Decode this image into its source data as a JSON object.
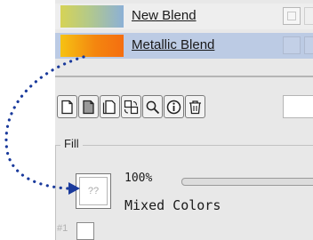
{
  "blends": [
    {
      "name": "New Blend",
      "selected": false,
      "colors": [
        "#d6d356",
        "#8cb0d6"
      ]
    },
    {
      "name": "Metallic Blend",
      "selected": true,
      "colors": [
        "#f6c213",
        "#f46e10"
      ]
    }
  ],
  "toolbar": {
    "buttons": [
      {
        "name": "new-blend-button",
        "icon": "new-document-icon"
      },
      {
        "name": "duplicate-blend-button",
        "icon": "copy-document-icon"
      },
      {
        "name": "blank-blend-button",
        "icon": "blank-document-icon"
      },
      {
        "name": "convert-blend-button",
        "icon": "convert-icon"
      },
      {
        "name": "find-blend-button",
        "icon": "search-icon"
      },
      {
        "name": "info-button",
        "icon": "info-icon"
      },
      {
        "name": "delete-button",
        "icon": "trash-icon"
      }
    ]
  },
  "fill": {
    "legend": "Fill",
    "preview_text": "??",
    "percent": "100%",
    "status": "Mixed Colors",
    "stop_label": "#1"
  },
  "colors": {
    "panel": "#e8e8e8",
    "selection": "#bccbe4",
    "arrow": "#1a3a9c"
  }
}
